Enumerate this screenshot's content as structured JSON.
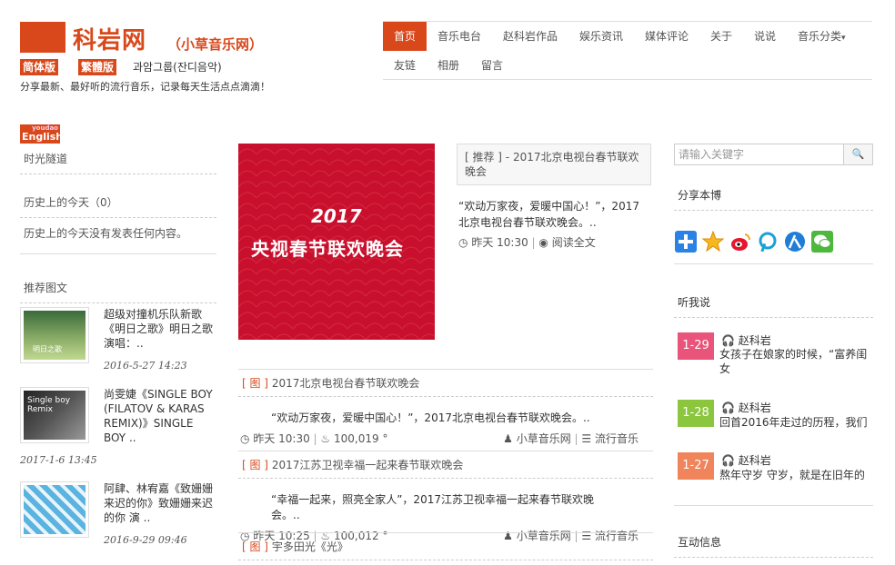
{
  "site": {
    "title": "科岩网",
    "subtitle": "（小草音乐网）",
    "lang_simp": "简体版",
    "lang_trad": "繁體版",
    "korean": "과암그룹(잔디음악)",
    "tagline": "分享最新、最好听的流行音乐，记录每天生活点点滴滴！",
    "youdao_small": "youdao",
    "youdao_en": "English"
  },
  "nav": {
    "items": [
      "首页",
      "音乐电台",
      "赵科岩作品",
      "娱乐资讯",
      "媒体评论",
      "关于",
      "说说",
      "音乐分类"
    ],
    "items2": [
      "友链",
      "相册",
      "留言"
    ],
    "caret": "▾"
  },
  "left": {
    "time_tunnel": "时光隧道",
    "history_title": "历史上的今天（0）",
    "history_text": "历史上的今天没有发表任何内容。",
    "recommend_title": "推荐图文",
    "items": [
      {
        "text": "超级对撞机乐队新歌《明日之歌》明日之歌 演唱：..",
        "date": "2016-5-27  14:23",
        "thumb_text": "明日之歌"
      },
      {
        "text": "尚雯婕《SINGLE BOY (FILATOV & KARAS REMIX)》SINGLE BOY ..",
        "date": "2017-1-6  13:45",
        "thumb_text": "Single boy Remix"
      },
      {
        "text": "阿肆、林宥嘉《致姗姗来迟的你》致姗姗来迟的你 演 ..",
        "date": "2016-9-29  09:46",
        "thumb_text": ""
      }
    ]
  },
  "featured": {
    "image_text": "央视春节联欢晚会",
    "image_logo": "2017",
    "title": "[ 推荐 ] - 2017北京电视台春节联欢晚会",
    "excerpt": "“欢动万家夜，爱暖中国心！”，2017北京电视台春节联欢晚会。..",
    "time": "昨天 10:30",
    "read_more": "阅读全文"
  },
  "posts": [
    {
      "tag": "[ 图 ]",
      "title": "2017北京电视台春节联欢晚会",
      "excerpt": "“欢动万家夜，爱暖中国心！”，2017北京电视台春节联欢晚会。..",
      "time": "昨天 10:30",
      "views": "100,019 °",
      "author": "小草音乐网",
      "category": "流行音乐"
    },
    {
      "tag": "[ 图 ]",
      "title": "2017江苏卫视幸福一起来春节联欢晚会",
      "excerpt": "“幸福一起来，照亮全家人”，2017江苏卫视幸福一起来春节联欢晚会。..",
      "time": "昨天 10:25",
      "views": "100,012 °",
      "author": "小草音乐网",
      "category": "流行音乐"
    },
    {
      "tag": "[ 图 ]",
      "title": "宇多田光《光》",
      "excerpt": "",
      "time": "",
      "views": "",
      "author": "",
      "category": ""
    }
  ],
  "right": {
    "search_placeholder": "请输入关键字",
    "search_icon": "🔍",
    "share_title": "分享本博",
    "share_icons": [
      "plus-share",
      "qzone",
      "weibo",
      "tencent-weibo",
      "renren",
      "wechat"
    ],
    "listen_title": "听我说",
    "messages": [
      {
        "date": "1-29",
        "author": "赵科岩",
        "text": "女孩子在娘家的时候，“富养闺女",
        "color": "#e8547a"
      },
      {
        "date": "1-28",
        "author": "赵科岩",
        "text": "回首2016年走过的历程，我们",
        "color": "#8cc63f"
      },
      {
        "date": "1-27",
        "author": "赵科岩",
        "text": "熬年守岁 守岁，就是在旧年的",
        "color": "#f0845a"
      }
    ],
    "interact_title": "互动信息"
  },
  "colors": {
    "accent": "#d9481b"
  }
}
